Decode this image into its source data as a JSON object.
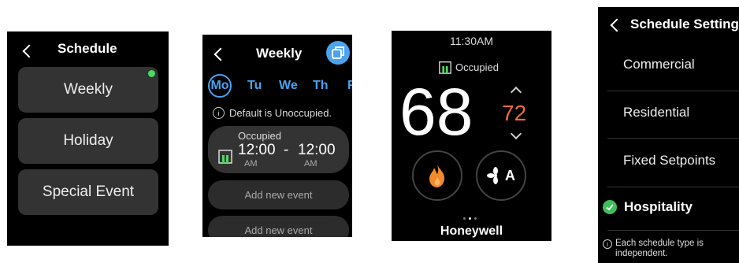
{
  "schedule": {
    "title": "Schedule",
    "items": [
      {
        "label": "Weekly"
      },
      {
        "label": "Holiday"
      },
      {
        "label": "Special Event"
      }
    ],
    "active_dot_color": "#4cd964"
  },
  "weekly": {
    "title": "Weekly",
    "days": [
      "Mo",
      "Tu",
      "We",
      "Th",
      "F"
    ],
    "selected_day": "Mo",
    "info": "Default is Unoccupied.",
    "event": {
      "label": "Occupied",
      "start_time": "12:00",
      "start_ampm": "AM",
      "separator": "-",
      "end_time": "12:00",
      "end_ampm": "AM"
    },
    "add_labels": [
      "Add new event",
      "Add new event"
    ],
    "accent_color": "#4aa3f0"
  },
  "thermostat": {
    "time": "11:30AM",
    "status": "Occupied",
    "current_temp": "68",
    "setpoint": "72",
    "setpoint_color": "#f26b3a",
    "fan_mode": "A",
    "brand": "Honeywell",
    "page_dots": 3
  },
  "schedule_setting": {
    "title": "Schedule Setting",
    "options": [
      {
        "label": "Commercial"
      },
      {
        "label": "Residential"
      },
      {
        "label": "Fixed Setpoints"
      },
      {
        "label": "Hospitality"
      }
    ],
    "selected": "Hospitality",
    "check_color": "#3fbf5a",
    "footer": "Each schedule type is independent."
  }
}
